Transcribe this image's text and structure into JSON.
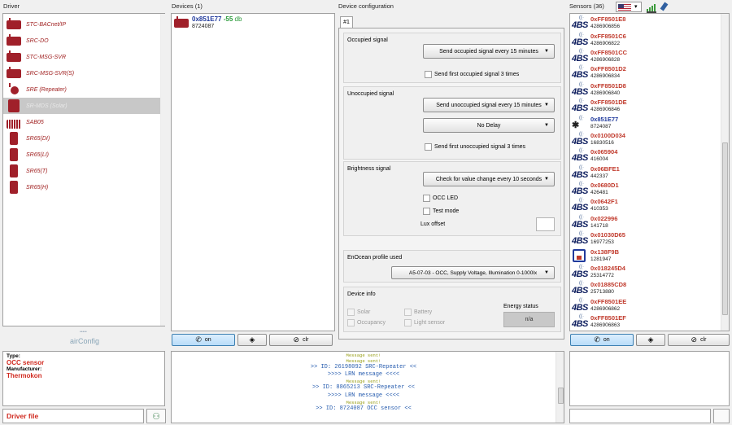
{
  "headers": {
    "driver": "Driver",
    "devices": "Devices (1)",
    "config": "Device configuration",
    "sensors": "Sensors (36)"
  },
  "drivers": [
    {
      "label": "STC-BACnet/IP",
      "icon": "controller-icon"
    },
    {
      "label": "SRC-DO",
      "icon": "controller-icon"
    },
    {
      "label": "STC-MSG-SVR",
      "icon": "controller-icon"
    },
    {
      "label": "SRC-MSG-SVR(S)",
      "icon": "controller-icon"
    },
    {
      "label": "SRE (Repeater)",
      "icon": "repeater-icon"
    },
    {
      "label": "SR-MDS (Solar)",
      "icon": "motion-sensor-icon",
      "selected": true
    },
    {
      "label": "SAB05",
      "icon": "valve-icon"
    },
    {
      "label": "SR65(DI)",
      "icon": "sensor-icon"
    },
    {
      "label": "SR65(LI)",
      "icon": "sensor-icon"
    },
    {
      "label": "SR65(T)",
      "icon": "sensor-icon"
    },
    {
      "label": "SR65(H)",
      "icon": "sensor-icon"
    }
  ],
  "logo": "airConfig",
  "info": {
    "type_label": "Type:",
    "type_value": "OCC sensor",
    "manufacturer_label": "Manufacturer:",
    "manufacturer_value": "Thermokon"
  },
  "driver_file": "Driver file",
  "device": {
    "id": "0x851E77",
    "signal": "-55",
    "signal_unit": "db",
    "num": "8724087"
  },
  "buttons": {
    "on": "on",
    "off": "off",
    "clr": "clr"
  },
  "config": {
    "tab": "#1",
    "occupied": {
      "title": "Occupied signal",
      "select": "Send occupied signal every 15 minutes",
      "check": "Send first occupied signal 3 times"
    },
    "unoccupied": {
      "title": "Unoccupied signal",
      "select": "Send unoccupied signal every 15 minutes",
      "delay": "No Delay",
      "check": "Send first unoccupied signal 3 times"
    },
    "brightness": {
      "title": "Brightness signal",
      "select": "Check for value change every 10 seconds",
      "occ_led": "OCC LED",
      "test_mode": "Test mode",
      "lux_offset": "Lux offset"
    },
    "profile": {
      "title": "EnOcean profile used",
      "select": "A5-07-03  -  OCC, Supply Voltage, Illumination 0-1000lx"
    },
    "info": {
      "title": "Device info",
      "solar": "Solar",
      "battery": "Battery",
      "occupancy": "Occupancy",
      "light_sensor": "Light sensor",
      "energy_status": "Energy status",
      "energy_value": "n/a"
    }
  },
  "log": [
    {
      "text": "Message sent!",
      "kind": "ok"
    },
    {
      "text": "Message sent!",
      "kind": "ok"
    },
    {
      "text": ">> ID: 26198092 SRC-Repeater <<",
      "kind": "id"
    },
    {
      "text": ">>>> LRN message <<<<",
      "kind": "id"
    },
    {
      "text": "Message sent!",
      "kind": "ok"
    },
    {
      "text": ">> ID: 8865213 SRC-Repeater <<",
      "kind": "id"
    },
    {
      "text": ">>>> LRN message <<<<",
      "kind": "id"
    },
    {
      "text": "Message sent!",
      "kind": "ok"
    },
    {
      "text": ">> ID: 8724087 OCC sensor <<",
      "kind": "id"
    }
  ],
  "sensors": [
    {
      "id": "0xFF8501E8",
      "num": "4286906856",
      "icon": "abs"
    },
    {
      "id": "0xFF8501C6",
      "num": "4286906822",
      "icon": "abs"
    },
    {
      "id": "0xFF8501CC",
      "num": "4286906828",
      "icon": "abs"
    },
    {
      "id": "0xFF8501D2",
      "num": "4286906834",
      "icon": "abs"
    },
    {
      "id": "0xFF8501D8",
      "num": "4286906840",
      "icon": "abs"
    },
    {
      "id": "0xFF8501DE",
      "num": "4286906846",
      "icon": "abs"
    },
    {
      "id": "0x851E77",
      "num": "8724087",
      "icon": "motion",
      "blue": true
    },
    {
      "id": "0x0100D034",
      "num": "16830516",
      "icon": "abs"
    },
    {
      "id": "0x065904",
      "num": "416004",
      "icon": "abs"
    },
    {
      "id": "0x06BFE1",
      "num": "442337",
      "icon": "abs"
    },
    {
      "id": "0x0680D1",
      "num": "426481",
      "icon": "abs"
    },
    {
      "id": "0x0642F1",
      "num": "410353",
      "icon": "abs"
    },
    {
      "id": "0x022996",
      "num": "141718",
      "icon": "abs"
    },
    {
      "id": "0x01030D65",
      "num": "16977253",
      "icon": "abs"
    },
    {
      "id": "0x138F9B",
      "num": "1281947",
      "icon": "switch"
    },
    {
      "id": "0x018245D4",
      "num": "25314772",
      "icon": "abs"
    },
    {
      "id": "0x01885CD8",
      "num": "25713880",
      "icon": "abs"
    },
    {
      "id": "0xFF8501EE",
      "num": "4286906862",
      "icon": "abs"
    },
    {
      "id": "0xFF8501EF",
      "num": "4286906863",
      "icon": "abs"
    }
  ]
}
